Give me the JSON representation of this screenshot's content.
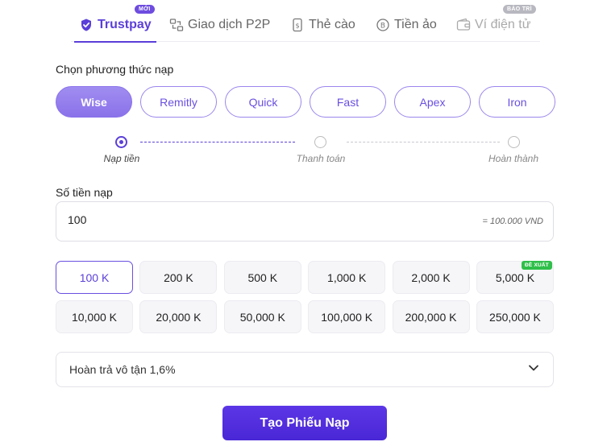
{
  "tabs": [
    {
      "label": "Trustpay",
      "icon": "shield-check-icon",
      "badge": "MỚI"
    },
    {
      "label": "Giao dịch P2P",
      "icon": "p2p-exchange-icon"
    },
    {
      "label": "Thẻ cào",
      "icon": "scratch-card-icon"
    },
    {
      "label": "Tiền ảo",
      "icon": "bitcoin-icon"
    },
    {
      "label": "Ví điện tử",
      "icon": "wallet-icon",
      "badge": "BẢO TRÌ"
    }
  ],
  "method_section": {
    "label": "Chọn phương thức nạp",
    "methods": [
      "Wise",
      "Remitly",
      "Quick",
      "Fast",
      "Apex",
      "Iron"
    ],
    "selected": "Wise"
  },
  "steps": [
    "Nạp tiền",
    "Thanh toán",
    "Hoàn thành"
  ],
  "amount": {
    "label": "Số tiền nạp",
    "value": "100",
    "converted": "= 100.000 VND"
  },
  "presets": [
    "100 K",
    "200 K",
    "500 K",
    "1,000 K",
    "2,000 K",
    "5,000 K",
    "10,000 K",
    "20,000 K",
    "50,000 K",
    "100,000 K",
    "200,000 K",
    "250,000 K"
  ],
  "preset_selected": "100 K",
  "preset_recommended_badge": "ĐỀ XUẤT",
  "refund": {
    "text": "Hoàn trả vô tận 1,6%"
  },
  "submit_label": "Tạo Phiếu Nạp",
  "colors": {
    "accent": "#5b3fd8",
    "badge_green": "#2fbf4a"
  }
}
